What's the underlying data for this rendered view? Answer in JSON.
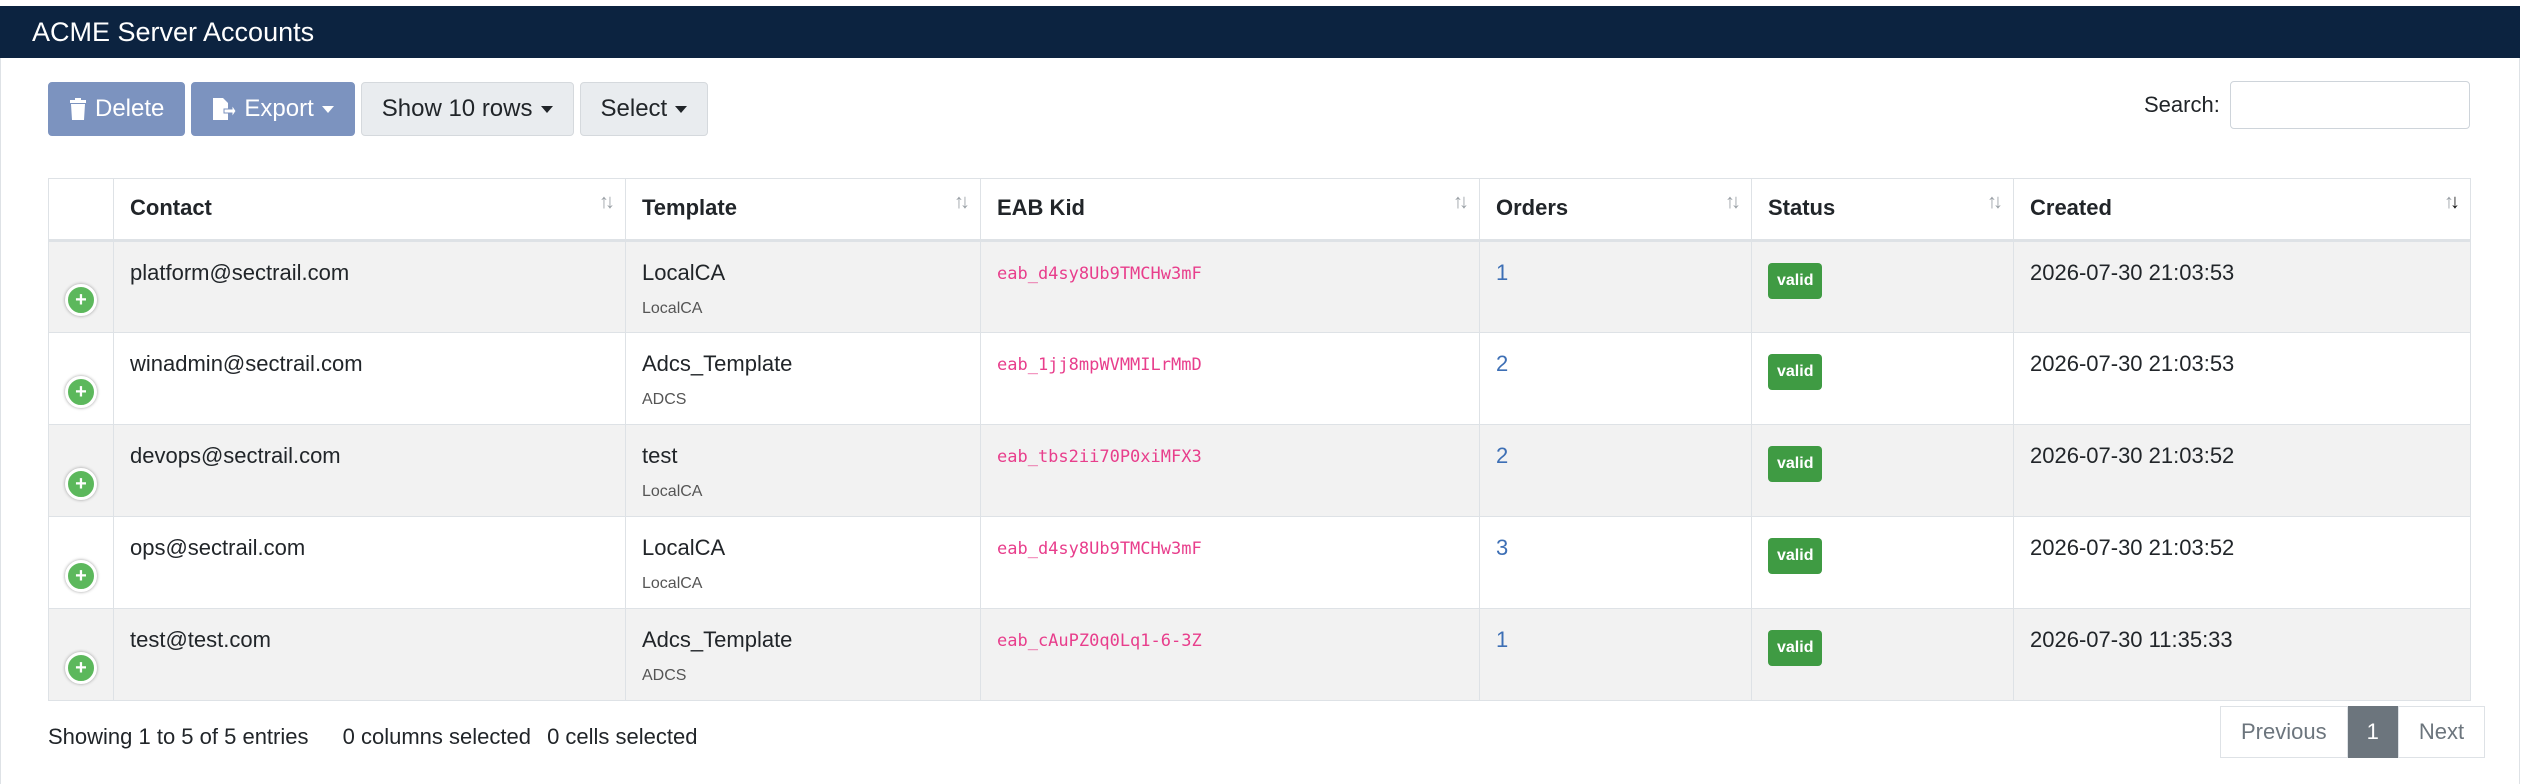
{
  "window": {
    "title": "ACME Server Accounts"
  },
  "toolbar": {
    "delete_label": "Delete",
    "export_label": "Export",
    "show_rows_label": "Show 10 rows",
    "select_label": "Select"
  },
  "search": {
    "label": "Search:",
    "value": "",
    "placeholder": ""
  },
  "table": {
    "columns": [
      "Contact",
      "Template",
      "EAB Kid",
      "Orders",
      "Status",
      "Created"
    ],
    "rows": [
      {
        "contact": "platform@sectrail.com",
        "template": "LocalCA",
        "template_type": "LocalCA",
        "eab_kid": "eab_d4sy8Ub9TMCHw3mF",
        "orders": "1",
        "status": "valid",
        "created": "2026-07-30 21:03:53"
      },
      {
        "contact": "winadmin@sectrail.com",
        "template": "Adcs_Template",
        "template_type": "ADCS",
        "eab_kid": "eab_1jj8mpWVMMILrMmD",
        "orders": "2",
        "status": "valid",
        "created": "2026-07-30 21:03:53"
      },
      {
        "contact": "devops@sectrail.com",
        "template": "test",
        "template_type": "LocalCA",
        "eab_kid": "eab_tbs2ii70P0xiMFX3",
        "orders": "2",
        "status": "valid",
        "created": "2026-07-30 21:03:52"
      },
      {
        "contact": "ops@sectrail.com",
        "template": "LocalCA",
        "template_type": "LocalCA",
        "eab_kid": "eab_d4sy8Ub9TMCHw3mF",
        "orders": "3",
        "status": "valid",
        "created": "2026-07-30 21:03:52"
      },
      {
        "contact": "test@test.com",
        "template": "Adcs_Template",
        "template_type": "ADCS",
        "eab_kid": "eab_cAuPZ0q0Lq1-6-3Z",
        "orders": "1",
        "status": "valid",
        "created": "2026-07-30 11:35:33"
      }
    ]
  },
  "footer": {
    "showing": "Showing 1 to 5 of 5 entries",
    "columns_selected": "0 columns selected",
    "cells_selected": "0 cells selected"
  },
  "pagination": {
    "previous": "Previous",
    "current": "1",
    "next": "Next"
  },
  "colors": {
    "header_bg": "#0c2340",
    "button_blue": "#7c93bf",
    "valid_badge": "#3f9b43",
    "eab_code": "#e83e8c",
    "link": "#3d6fb5"
  },
  "icons": {
    "delete": "trash-icon",
    "export": "export-file-icon",
    "expand": "plus-circle-icon",
    "sort": "sort-arrows-icon"
  }
}
